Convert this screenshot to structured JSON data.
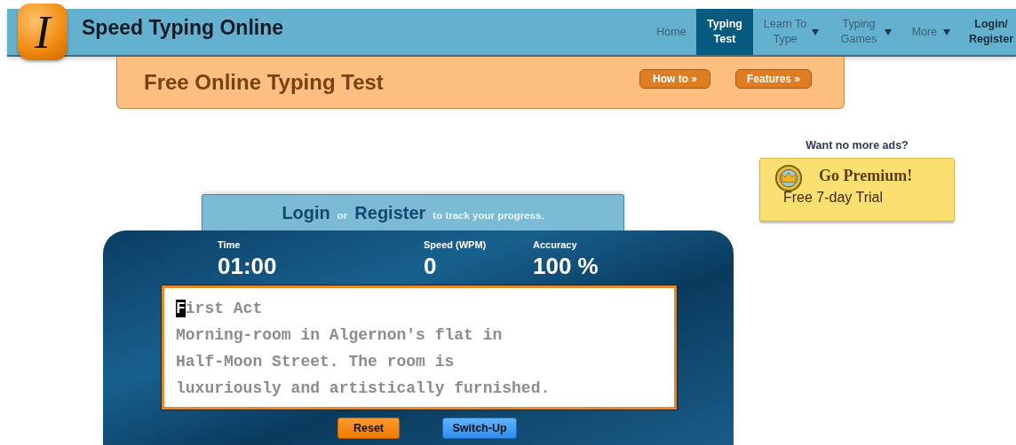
{
  "header": {
    "logo_letter": "I",
    "site_title": "Speed Typing Online",
    "nav": [
      {
        "label": "Home",
        "selected": false,
        "dropdown": false,
        "bold": false
      },
      {
        "label": "Typing Test",
        "selected": true,
        "dropdown": false,
        "bold": true
      },
      {
        "label": "Learn To Type",
        "selected": false,
        "dropdown": true,
        "bold": false
      },
      {
        "label": "Typing Games",
        "selected": false,
        "dropdown": true,
        "bold": false
      },
      {
        "label": "More",
        "selected": false,
        "dropdown": true,
        "bold": false
      },
      {
        "label": "Login/ Register",
        "selected": false,
        "dropdown": false,
        "bold": true
      }
    ]
  },
  "banner": {
    "title": "Free Online Typing Test",
    "buttons": [
      "How to »",
      "Features »"
    ]
  },
  "ad": {
    "prompt": "Want no more ads?",
    "title": "Go Premium!",
    "subtitle": "Free 7-day Trial"
  },
  "login_bar": {
    "login": "Login",
    "or": "or",
    "register": "Register",
    "note": "to track your progress."
  },
  "stats": [
    {
      "label": "Time",
      "value": "01:00"
    },
    {
      "label": "Speed (WPM)",
      "value": "0"
    },
    {
      "label": "Accuracy",
      "value": "100 %"
    }
  ],
  "passage": [
    {
      "segments": [
        {
          "text": "F",
          "current": true
        },
        {
          "text": "irst Act",
          "current": false
        }
      ]
    },
    {
      "segments": [
        {
          "text": "Morning-room in Algernon's flat in",
          "current": false
        }
      ]
    },
    {
      "segments": [
        {
          "text": "Half-Moon Street. The room is",
          "current": false
        }
      ]
    },
    {
      "segments": [
        {
          "text": "luxuriously and artistically furnished.",
          "current": false
        }
      ]
    }
  ],
  "controls": [
    {
      "label": "Reset",
      "kind": "reset"
    },
    {
      "label": "Switch-Up",
      "kind": "switch"
    }
  ]
}
